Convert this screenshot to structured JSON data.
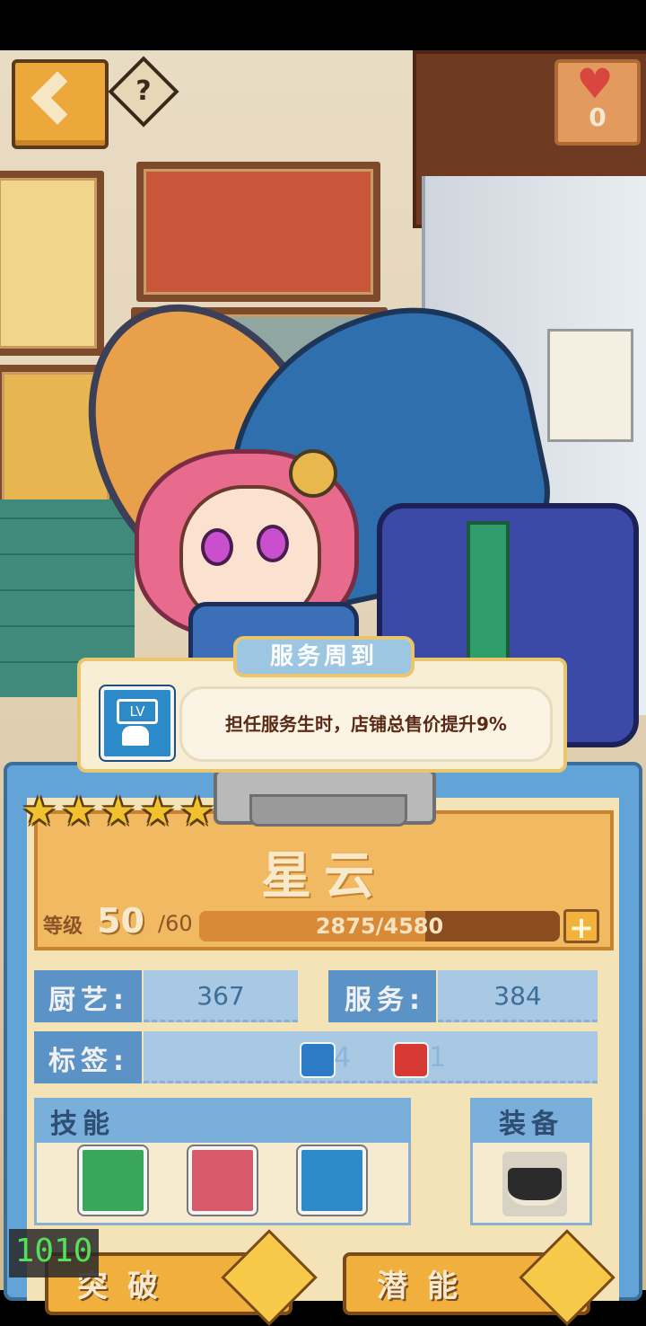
{
  "top_bar": {
    "help_symbol": "?"
  },
  "hearts": {
    "count": "0"
  },
  "tooltip": {
    "title": "服务周到",
    "description": "担任服务生时，店铺总售价提升9%",
    "icon_badge": "LV"
  },
  "character": {
    "name": "星云",
    "stars": 5,
    "level_label": "等级",
    "level": "50",
    "level_max": "/60",
    "exp_text": "2875/4580",
    "exp_fraction": 0.628
  },
  "stats": {
    "cooking_label": "厨艺:",
    "cooking_value": "367",
    "service_label": "服务:",
    "service_value": "384",
    "tags_label": "标签:",
    "tag1_count": "4",
    "tag2_count": "1"
  },
  "skills": {
    "title": "技能",
    "items": [
      "stopwatch-speed-icon",
      "thumbs-up-icon",
      "service-level-up-icon"
    ]
  },
  "equipment": {
    "title": "装备",
    "item": "black-skirt-icon"
  },
  "buttons": {
    "breakthrough": "突破",
    "potential": "潜能"
  },
  "fps": {
    "value": "1010"
  },
  "colors": {
    "panel_blue": "#62a4d8",
    "gold": "#f1b961",
    "exp_fill": "#d98a37",
    "fps_green": "#55e05a"
  }
}
